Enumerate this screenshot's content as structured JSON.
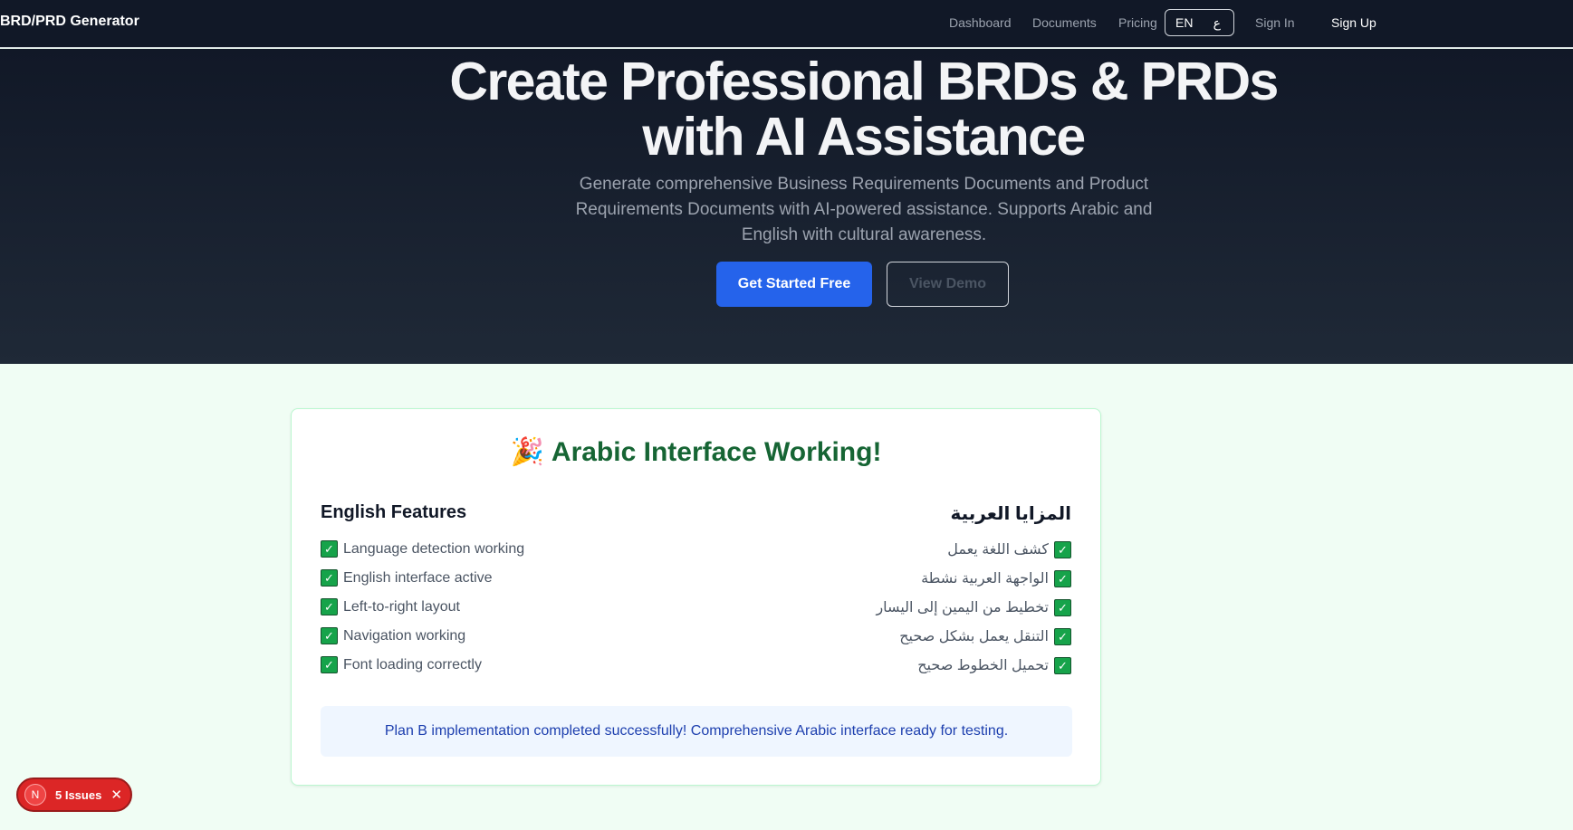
{
  "nav": {
    "brand": "BRD/PRD Generator",
    "links": [
      "Dashboard",
      "Documents",
      "Pricing"
    ],
    "lang_en": "EN",
    "lang_ar": "ع",
    "sign_in": "Sign In",
    "sign_up": "Sign Up"
  },
  "hero": {
    "title_line1": "Create Professional BRDs & PRDs",
    "title_line2": "with AI Assistance",
    "subtitle": "Generate comprehensive Business Requirements Documents and Product Requirements Documents with AI-powered assistance. Supports Arabic and English with cultural awareness.",
    "primary_cta": "Get Started Free",
    "secondary_cta": "View Demo"
  },
  "card": {
    "emoji": "🎉",
    "title": "Arabic Interface Working!",
    "english_title": "English Features",
    "arabic_title": "المزايا العربية",
    "english_features": [
      "Language detection working",
      "English interface active",
      "Left-to-right layout",
      "Navigation working",
      "Font loading correctly"
    ],
    "arabic_features": [
      "كشف اللغة يعمل",
      "الواجهة العربية نشطة",
      "تخطيط من اليمين إلى اليسار",
      "التنقل يعمل بشكل صحيح",
      "تحميل الخطوط صحيح"
    ],
    "check_glyph": "✓",
    "banner": "Plan B implementation completed successfully! Comprehensive Arabic interface ready for testing."
  },
  "issues_badge": {
    "icon_letter": "N",
    "label": "5 Issues",
    "close": "✕"
  },
  "colors": {
    "nav_bg": "#111827",
    "primary": "#2563eb",
    "success": "#166534",
    "page_bg": "#f0fdf4",
    "issues": "#dc2626"
  }
}
